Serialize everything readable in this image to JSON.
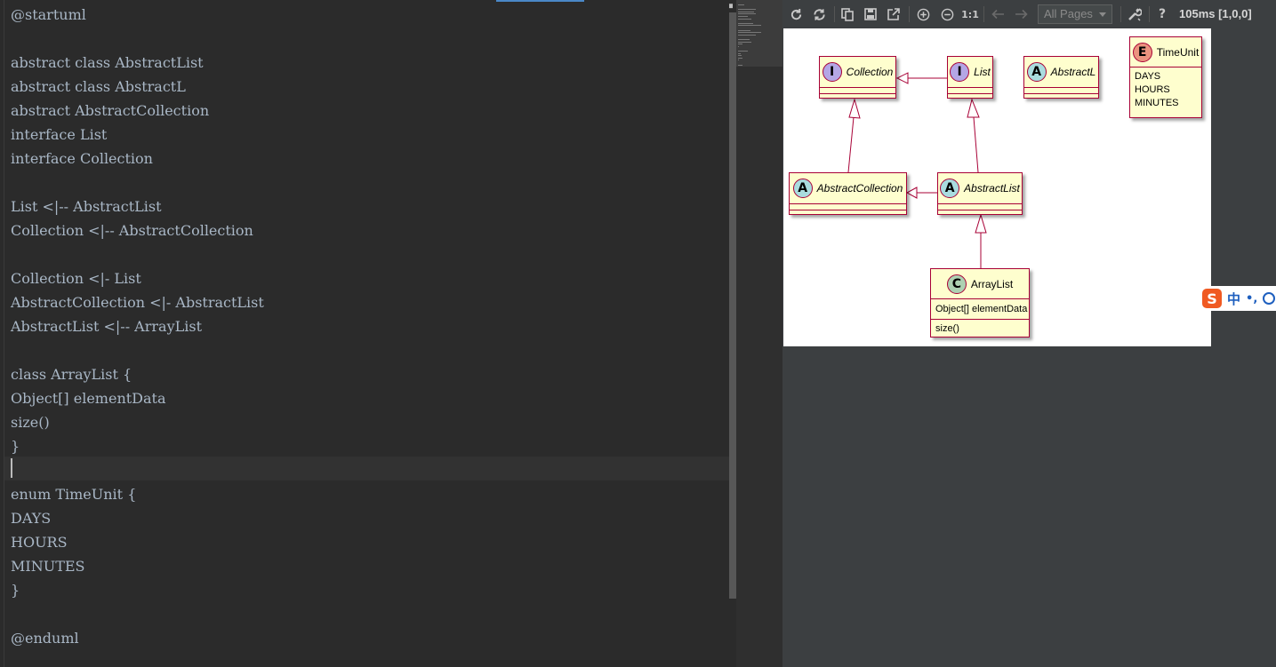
{
  "editor": {
    "lines": [
      "@startuml",
      "",
      "abstract class AbstractList",
      "abstract class AbstractL",
      "abstract AbstractCollection",
      "interface List",
      "interface Collection",
      "",
      "List <|-- AbstractList",
      "Collection <|-- AbstractCollection",
      "",
      "Collection <|- List",
      "AbstractCollection <|- AbstractList",
      "AbstractList <|-- ArrayList",
      "",
      "class ArrayList {",
      "Object[] elementData",
      "size()",
      "}",
      "",
      "enum TimeUnit {",
      "DAYS",
      "HOURS",
      "MINUTES",
      "}",
      "",
      "@enduml"
    ]
  },
  "toolbar": {
    "icons": [
      "refresh-icon",
      "sync-icon",
      "copy-icon",
      "save-icon",
      "external-icon",
      "zoom-in-icon",
      "zoom-out-icon",
      "back-icon",
      "forward-icon",
      "settings-icon",
      "help-icon"
    ],
    "zoom_actual_label": "1:1",
    "pages_value": "All Pages",
    "help_label": "?",
    "timing": "105ms [1,0,0]"
  },
  "diagram": {
    "collection": {
      "stereotype": "I",
      "name": "Collection"
    },
    "list": {
      "stereotype": "I",
      "name": "List"
    },
    "abstract_l": {
      "stereotype": "A",
      "name": "AbstractL"
    },
    "time_unit": {
      "stereotype": "E",
      "name": "TimeUnit",
      "values": [
        "DAYS",
        "HOURS",
        "MINUTES"
      ]
    },
    "abstract_collection": {
      "stereotype": "A",
      "name": "AbstractCollection"
    },
    "abstract_list": {
      "stereotype": "A",
      "name": "AbstractList"
    },
    "array_list": {
      "stereotype": "C",
      "name": "ArrayList",
      "field": "Object[] elementData",
      "method": "size()"
    }
  },
  "ime": {
    "logo": "S",
    "mode": "中",
    "punct": "•,"
  }
}
